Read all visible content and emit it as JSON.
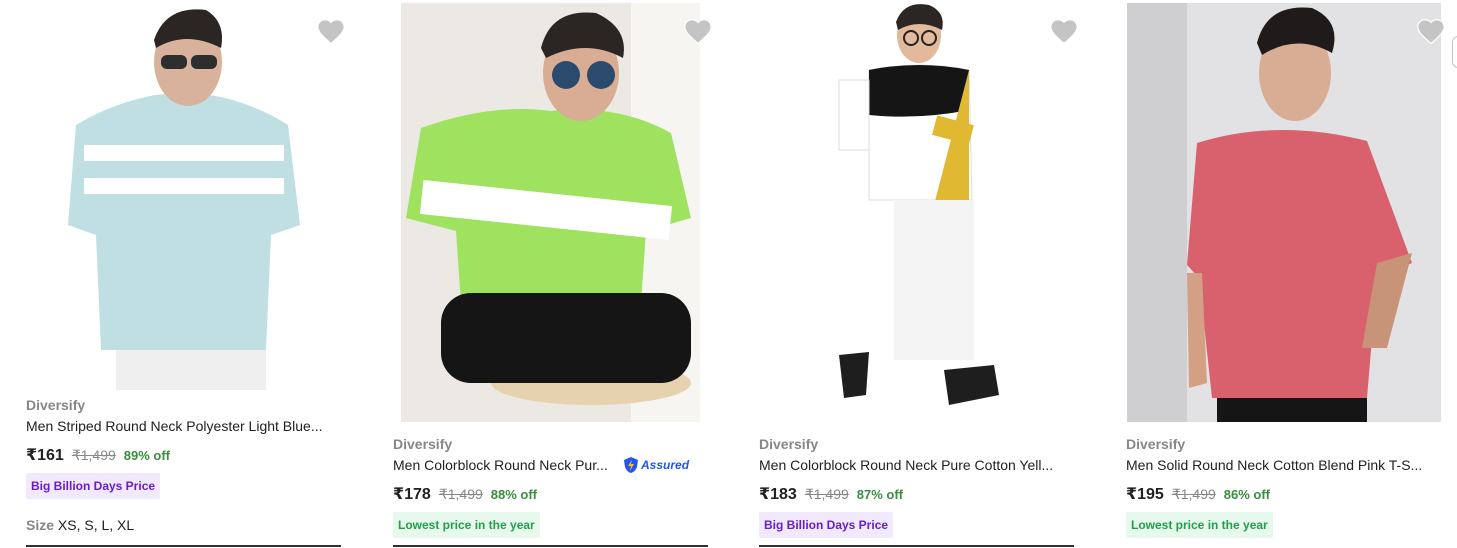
{
  "colors": {
    "brand_text": "#878787",
    "discount_green": "#388e3c",
    "big_billion_bg": "#f1eaff",
    "big_billion_text": "#6a1cc9",
    "lowest_price_bg": "#e7f8ec",
    "lowest_price_text": "#20a04a",
    "assured_blue": "#2455f4",
    "wishlist_heart": "#c4c4c4"
  },
  "products": [
    {
      "brand": "Diversify",
      "title": "Men Striped Round Neck Polyester Light Blue...",
      "price": "₹161",
      "mrp": "₹1,499",
      "discount": "89% off",
      "badge": "Big Billion Days Price",
      "badge_type": "big-billion",
      "size_label": "Size",
      "sizes": "XS, S, L, XL",
      "assured": false,
      "shirt_color": "#bfdfe2",
      "wishlist_icon": "heart-icon"
    },
    {
      "brand": "Diversify",
      "title": "Men Colorblock Round Neck Pur...",
      "price": "₹178",
      "mrp": "₹1,499",
      "discount": "88% off",
      "badge": "Lowest price in the year",
      "badge_type": "lowest-price",
      "assured": true,
      "assured_label": "Assured",
      "shirt_color": "#9ee25f",
      "wishlist_icon": "heart-icon"
    },
    {
      "brand": "Diversify",
      "title": "Men Colorblock Round Neck Pure Cotton Yell...",
      "price": "₹183",
      "mrp": "₹1,499",
      "discount": "87% off",
      "badge": "Big Billion Days Price",
      "badge_type": "big-billion",
      "assured": false,
      "shirt_color": "#e0b831",
      "wishlist_icon": "heart-icon"
    },
    {
      "brand": "Diversify",
      "title": "Men Solid Round Neck Cotton Blend Pink T-S...",
      "price": "₹195",
      "mrp": "₹1,499",
      "discount": "86% off",
      "badge": "Lowest price in the year",
      "badge_type": "lowest-price",
      "assured": false,
      "shirt_color": "#d9616e",
      "wishlist_icon": "heart-icon"
    }
  ]
}
